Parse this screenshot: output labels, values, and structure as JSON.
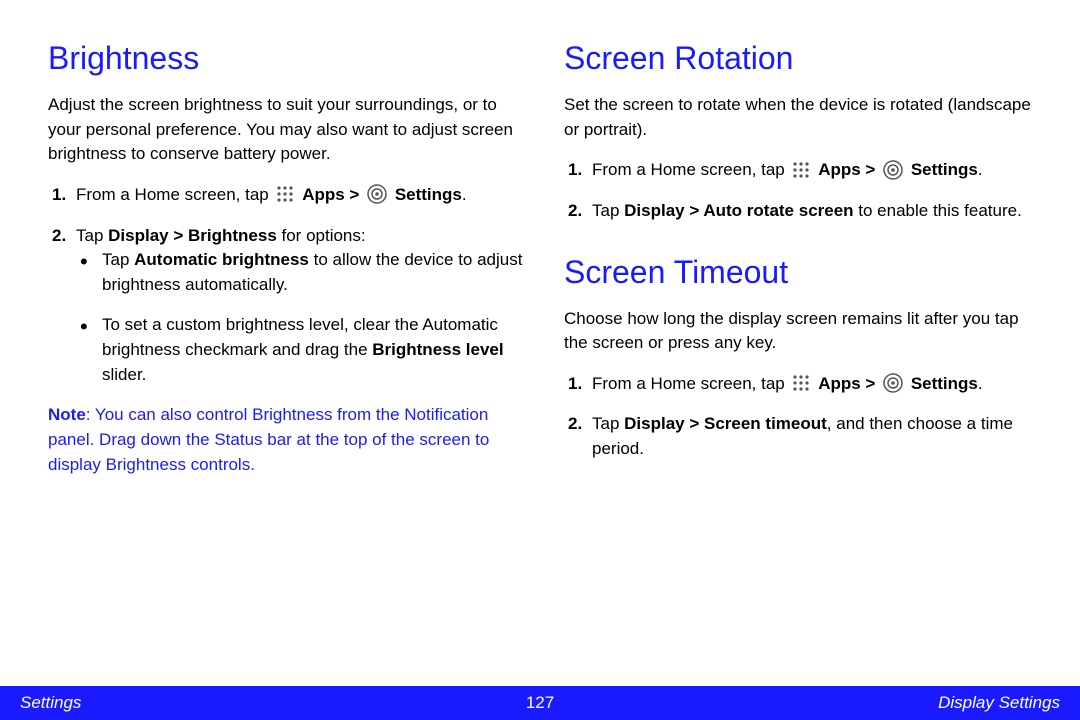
{
  "left": {
    "brightness": {
      "heading": "Brightness",
      "intro": "Adjust the screen brightness to suit your surroundings, or to your personal preference. You may also want to adjust screen brightness to conserve battery power.",
      "step1_pre": "From a Home screen, tap ",
      "apps_label": "Apps",
      "gt": " > ",
      "settings_label": "Settings",
      "period": ".",
      "step2_pre": "Tap ",
      "step2_bold": "Display > Brightness",
      "step2_post": " for options:",
      "bullet1_pre": "Tap ",
      "bullet1_bold": "Automatic brightness",
      "bullet1_post": " to allow the device to adjust brightness automatically.",
      "bullet2_pre": "To set a custom brightness level, clear the Automatic brightness checkmark and drag the ",
      "bullet2_bold": "Brightness level",
      "bullet2_post": " slider.",
      "note_label": "Note",
      "note_text": ": You can also control Brightness from the Notification panel. Drag down the Status bar at the top of the screen to display Brightness controls."
    }
  },
  "right": {
    "rotation": {
      "heading": "Screen Rotation",
      "intro": "Set the screen to rotate when the device is rotated (landscape or portrait).",
      "step1_pre": "From a Home screen, tap ",
      "apps_label": "Apps",
      "gt": " > ",
      "settings_label": "Settings",
      "period": ".",
      "step2_pre": "Tap ",
      "step2_bold": "Display > Auto rotate screen",
      "step2_post": " to enable this feature."
    },
    "timeout": {
      "heading": "Screen Timeout",
      "intro": "Choose how long the display screen remains lit after you tap the screen or press any key.",
      "step1_pre": "From a Home screen, tap ",
      "apps_label": "Apps",
      "gt": " > ",
      "settings_label": "Settings",
      "period": ".",
      "step2_pre": "Tap ",
      "step2_bold": "Display > Screen timeout",
      "step2_post": ", and then choose a time period."
    }
  },
  "footer": {
    "left": "Settings",
    "center": "127",
    "right": "Display Settings"
  }
}
